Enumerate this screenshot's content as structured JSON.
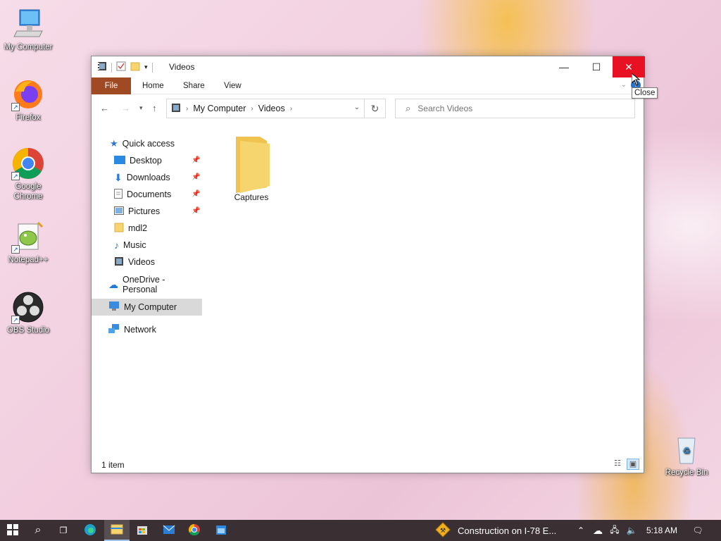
{
  "desktop": {
    "icons": [
      {
        "label": "My Computer"
      },
      {
        "label": "Firefox"
      },
      {
        "label": "Google Chrome"
      },
      {
        "label": "Notepad++"
      },
      {
        "label": "OBS Studio"
      },
      {
        "label": "Recycle Bin"
      }
    ]
  },
  "window": {
    "title": "Videos",
    "ribbon_tabs": [
      "File",
      "Home",
      "Share",
      "View"
    ],
    "address": {
      "segments": [
        "My Computer",
        "Videos"
      ]
    },
    "search": {
      "placeholder": "Search Videos"
    },
    "sidebar": {
      "quick_access": "Quick access",
      "quick_items": [
        {
          "label": "Desktop",
          "pinned": true
        },
        {
          "label": "Downloads",
          "pinned": true
        },
        {
          "label": "Documents",
          "pinned": true
        },
        {
          "label": "Pictures",
          "pinned": true
        },
        {
          "label": "mdl2",
          "pinned": false
        },
        {
          "label": "Music",
          "pinned": false
        },
        {
          "label": "Videos",
          "pinned": false
        }
      ],
      "onedrive": "OneDrive - Personal",
      "my_computer": "My Computer",
      "network": "Network"
    },
    "items": [
      {
        "name": "Captures"
      }
    ],
    "status": "1 item",
    "tooltip": "Close"
  },
  "taskbar": {
    "news": "Construction on I-78 E...",
    "time": "5:18 AM"
  },
  "colors": {
    "file_tab": "#a04a23",
    "close_button": "#e81123",
    "taskbar": "#3a2f33",
    "folder": "#f6d46e"
  }
}
